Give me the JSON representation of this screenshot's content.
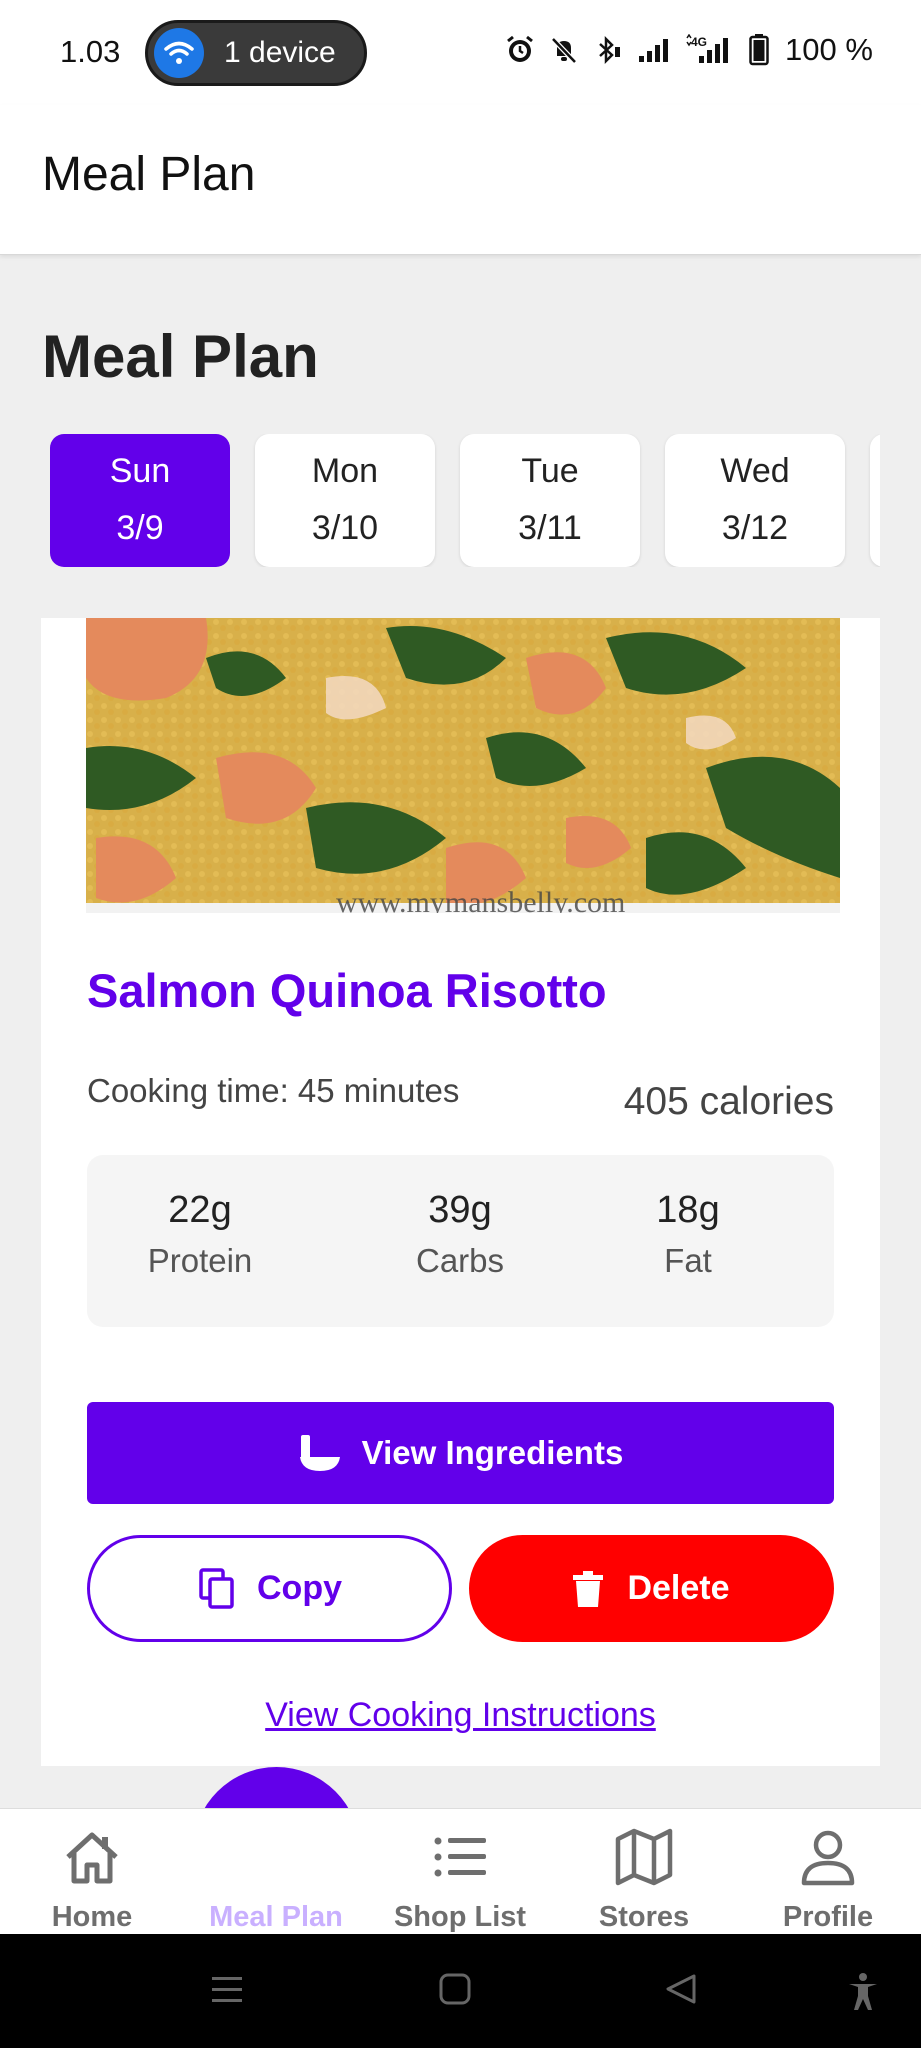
{
  "status_bar": {
    "time": "1.03",
    "device_pill": "1 device",
    "battery": "100 %"
  },
  "app_bar": {
    "title": "Meal Plan"
  },
  "page": {
    "title": "Meal Plan"
  },
  "days": [
    {
      "name": "Sun",
      "date": "3/9",
      "selected": true
    },
    {
      "name": "Mon",
      "date": "3/10",
      "selected": false
    },
    {
      "name": "Tue",
      "date": "3/11",
      "selected": false
    },
    {
      "name": "Wed",
      "date": "3/12",
      "selected": false
    }
  ],
  "meal": {
    "name": "Salmon Quinoa Risotto",
    "cooking_time": "Cooking time: 45 minutes",
    "calories": "405 calories",
    "macros": [
      {
        "value": "22g",
        "label": "Protein"
      },
      {
        "value": "39g",
        "label": "Carbs"
      },
      {
        "value": "18g",
        "label": "Fat"
      }
    ],
    "image_watermark": "www.mymansbelly.com"
  },
  "actions": {
    "view_ingredients": "View Ingredients",
    "copy": "Copy",
    "delete": "Delete",
    "view_instructions": "View Cooking Instructions"
  },
  "bottom_nav": {
    "items": [
      {
        "label": "Home",
        "icon": "home-icon"
      },
      {
        "label": "Meal Plan",
        "icon": "utensils-icon",
        "active": true
      },
      {
        "label": "Shop List",
        "icon": "list-icon"
      },
      {
        "label": "Stores",
        "icon": "map-icon"
      },
      {
        "label": "Profile",
        "icon": "person-icon"
      }
    ]
  },
  "colors": {
    "accent": "#6200ea",
    "danger": "#ff0000",
    "background": "#efefef"
  }
}
